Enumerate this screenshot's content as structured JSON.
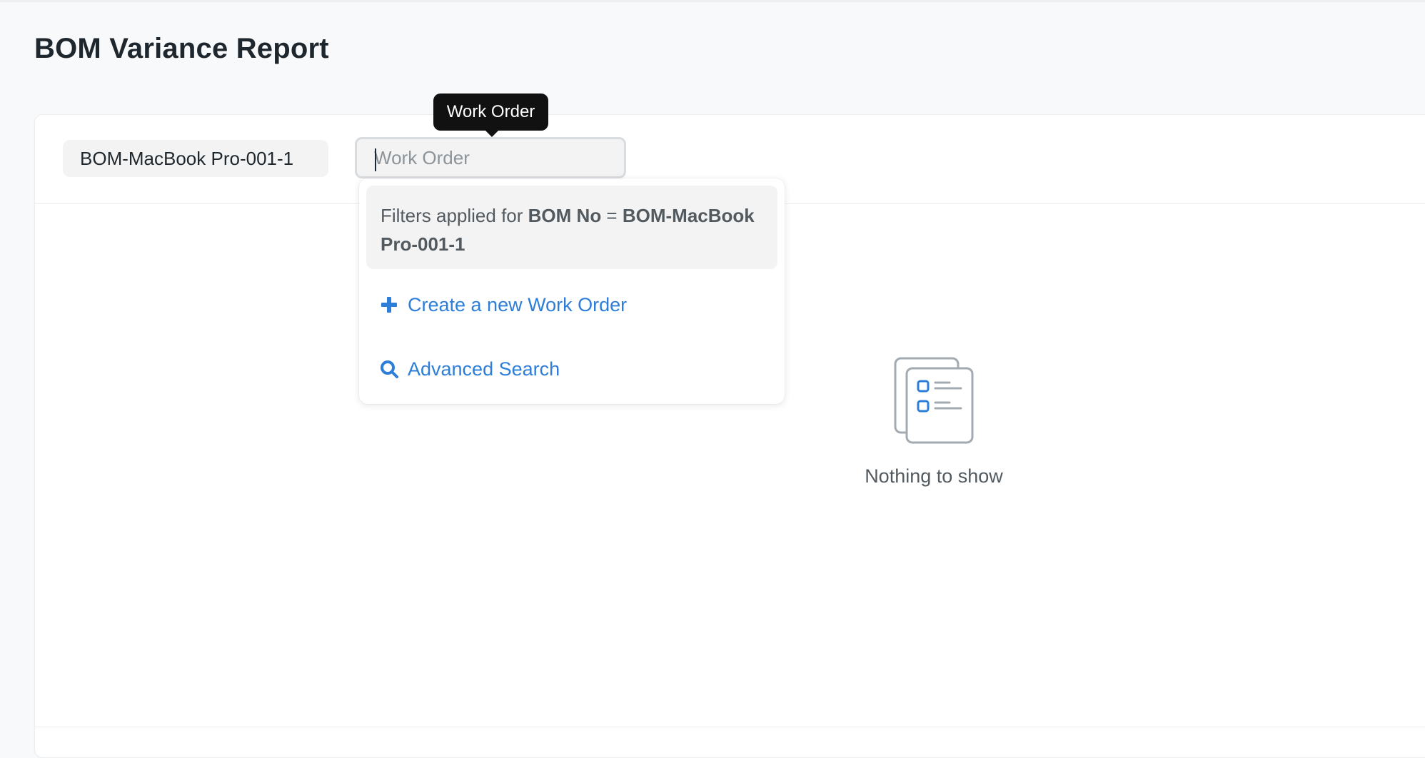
{
  "page": {
    "title": "BOM Variance Report"
  },
  "filters": {
    "bom_no_value": "BOM-MacBook Pro-001-1",
    "work_order_placeholder": "Work Order",
    "work_order_value": "",
    "work_order_tooltip": "Work Order"
  },
  "dropdown": {
    "filter_prefix": "Filters applied for ",
    "filter_field": "BOM No",
    "filter_operator": " = ",
    "filter_value": "BOM-MacBook Pro-001-1",
    "create_label": "Create a new Work Order",
    "advanced_search_label": "Advanced Search"
  },
  "empty_state": {
    "message": "Nothing to show",
    "icon": "empty-list-icon"
  },
  "colors": {
    "link": "#2d7ed8",
    "tooltip_bg": "#111111",
    "icon_gray": "#a3aab0",
    "icon_blue": "#2d7ed8"
  }
}
